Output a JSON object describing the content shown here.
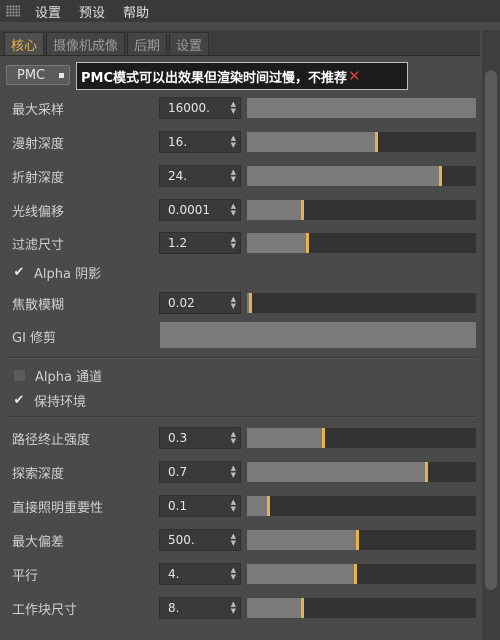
{
  "menubar": {
    "items": [
      "设置",
      "预设",
      "帮助"
    ]
  },
  "tabs": [
    {
      "label": "核心",
      "active": true
    },
    {
      "label": "摄像机成像",
      "active": false
    },
    {
      "label": "后期",
      "active": false
    },
    {
      "label": "设置",
      "active": false
    }
  ],
  "pmc": {
    "label": "PMC"
  },
  "notice": {
    "text": "PMC模式可以出效果但渲染时间过慢，不推荐",
    "mark": "✕"
  },
  "params1": [
    {
      "label": "最大采样",
      "value": "16000.",
      "fraction": 1.0
    },
    {
      "label": "漫射深度",
      "value": "16.",
      "fraction": 0.57
    },
    {
      "label": "折射深度",
      "value": "24.",
      "fraction": 0.85
    },
    {
      "label": "光线偏移",
      "value": "0.0001",
      "fraction": 0.25
    },
    {
      "label": "过滤尺寸",
      "value": "1.2",
      "fraction": 0.27
    }
  ],
  "alpha_shadow": {
    "label": "Alpha 阴影",
    "checked": true
  },
  "focus_blur": {
    "label": "焦散模糊",
    "value": "0.02",
    "fraction": 0.02
  },
  "gi_clamp": {
    "label": "GI 修剪"
  },
  "alpha_channel": {
    "label": "Alpha 通道",
    "checked": false
  },
  "keep_env": {
    "label": "保持环境",
    "checked": true
  },
  "params2": [
    {
      "label": "路径终止强度",
      "value": "0.3",
      "fraction": 0.34
    },
    {
      "label": "探索深度",
      "value": "0.7",
      "fraction": 0.79
    },
    {
      "label": "直接照明重要性",
      "value": "0.1",
      "fraction": 0.1
    },
    {
      "label": "最大偏差",
      "value": "500.",
      "fraction": 0.49
    },
    {
      "label": "平行",
      "value": "4.",
      "fraction": 0.48
    },
    {
      "label": "工作块尺寸",
      "value": "8.",
      "fraction": 0.25
    }
  ],
  "colors": {
    "accent": "#e7b347",
    "panel": "#4a4a4a",
    "slider_fill": "#7a7a7a",
    "error": "#e23a2e"
  }
}
